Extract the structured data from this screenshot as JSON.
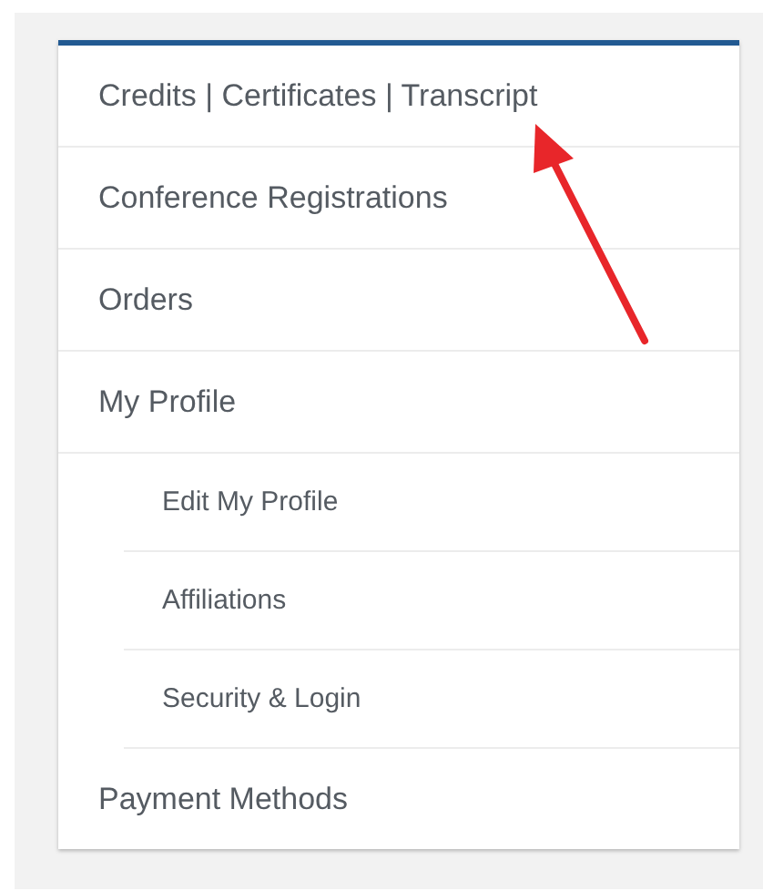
{
  "menu": {
    "items": [
      {
        "label": "Credits | Certificates | Transcript"
      },
      {
        "label": "Conference Registrations"
      },
      {
        "label": "Orders"
      },
      {
        "label": "My Profile",
        "children": [
          {
            "label": "Edit My Profile"
          },
          {
            "label": "Affiliations"
          },
          {
            "label": "Security & Login"
          }
        ]
      },
      {
        "label": "Payment Methods"
      }
    ]
  }
}
